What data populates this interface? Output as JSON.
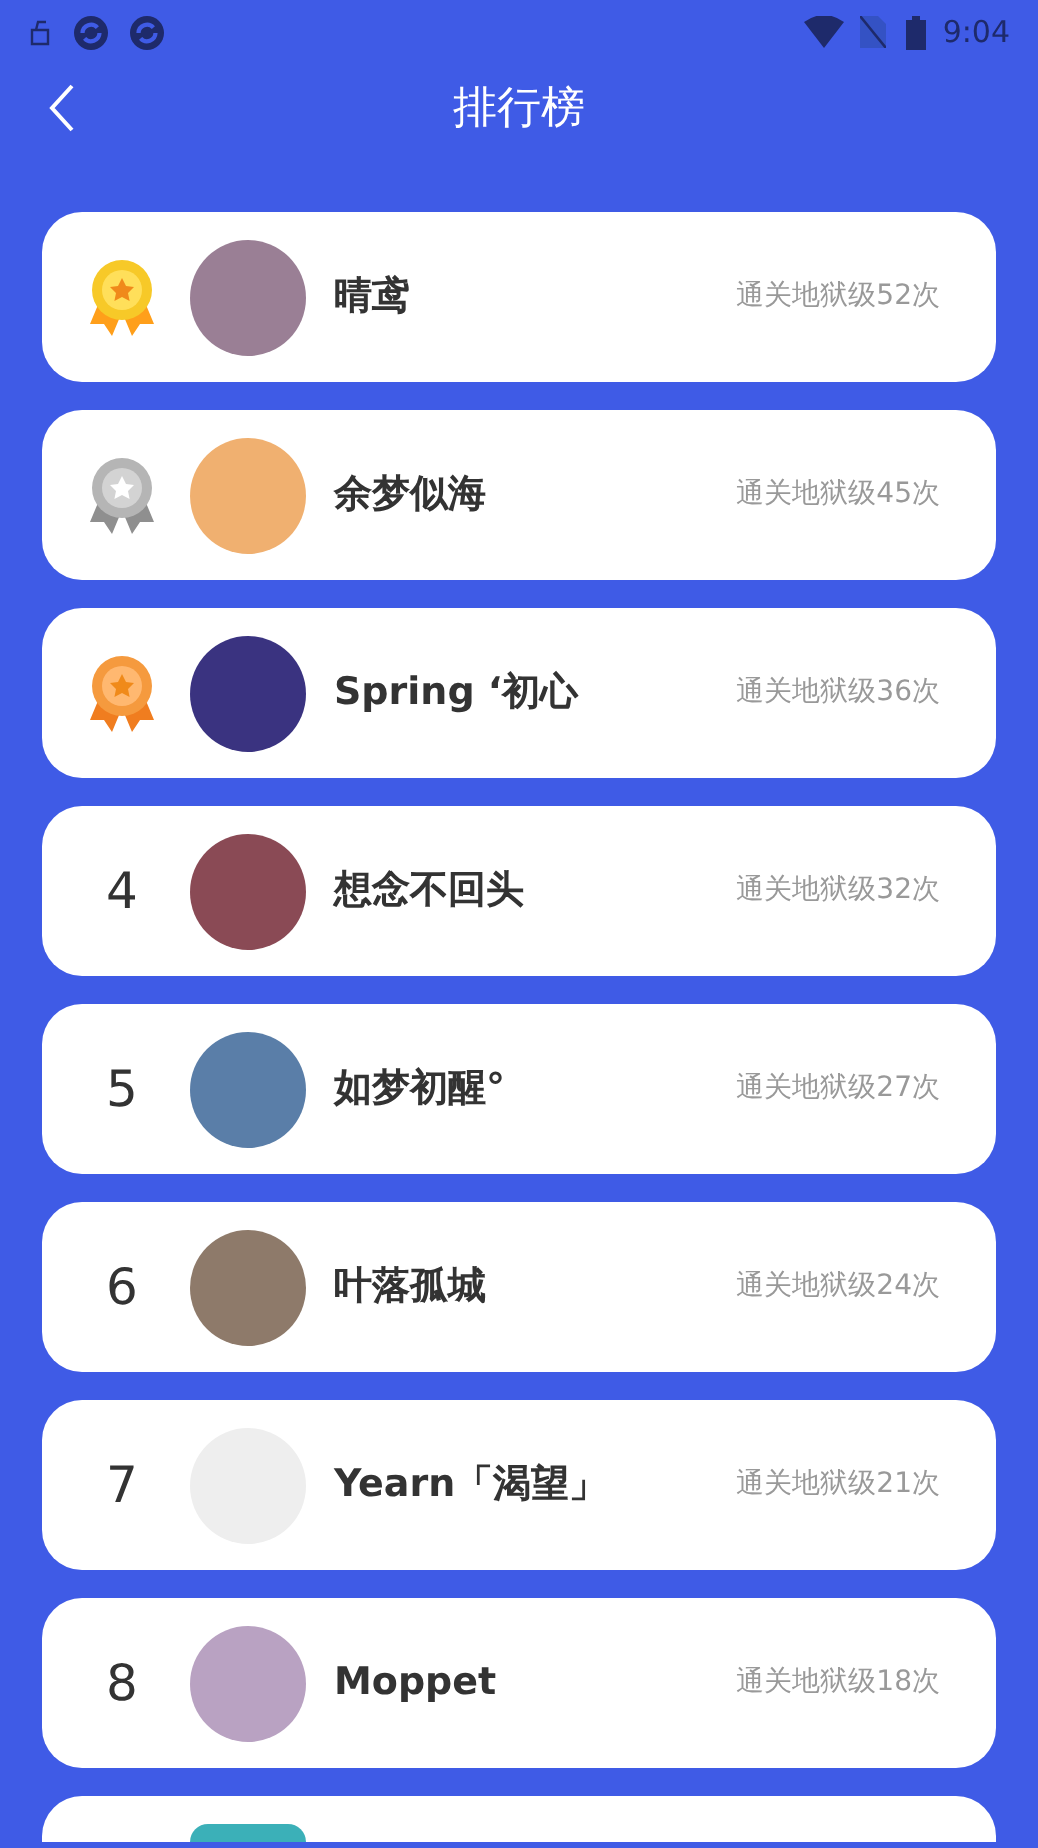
{
  "status_bar": {
    "time": "9:04"
  },
  "header": {
    "title": "排行榜"
  },
  "rows": [
    {
      "kind": "gold",
      "photo": true,
      "name": "晴鸢",
      "score": "通关地狱级52次"
    },
    {
      "kind": "silver",
      "photo": true,
      "name": "余梦似海",
      "score": "通关地狱级45次"
    },
    {
      "kind": "bronze",
      "photo": true,
      "name": "Spring ‘初心",
      "score": "通关地狱级36次"
    },
    {
      "kind": "number",
      "rank": "4",
      "photo": true,
      "name": "想念不回头",
      "score": "通关地狱级32次"
    },
    {
      "kind": "number",
      "rank": "5",
      "photo": true,
      "name": "如梦初醒°",
      "score": "通关地狱级27次"
    },
    {
      "kind": "number",
      "rank": "6",
      "photo": true,
      "name": "叶落孤城",
      "score": "通关地狱级24次"
    },
    {
      "kind": "number",
      "rank": "7",
      "photo": false,
      "name": "Yearn「渴望」",
      "score": "通关地狱级21次"
    },
    {
      "kind": "number",
      "rank": "8",
      "photo": true,
      "name": "Moppet",
      "score": "通关地狱级18次"
    },
    {
      "kind": "partial",
      "photo": true
    }
  ]
}
